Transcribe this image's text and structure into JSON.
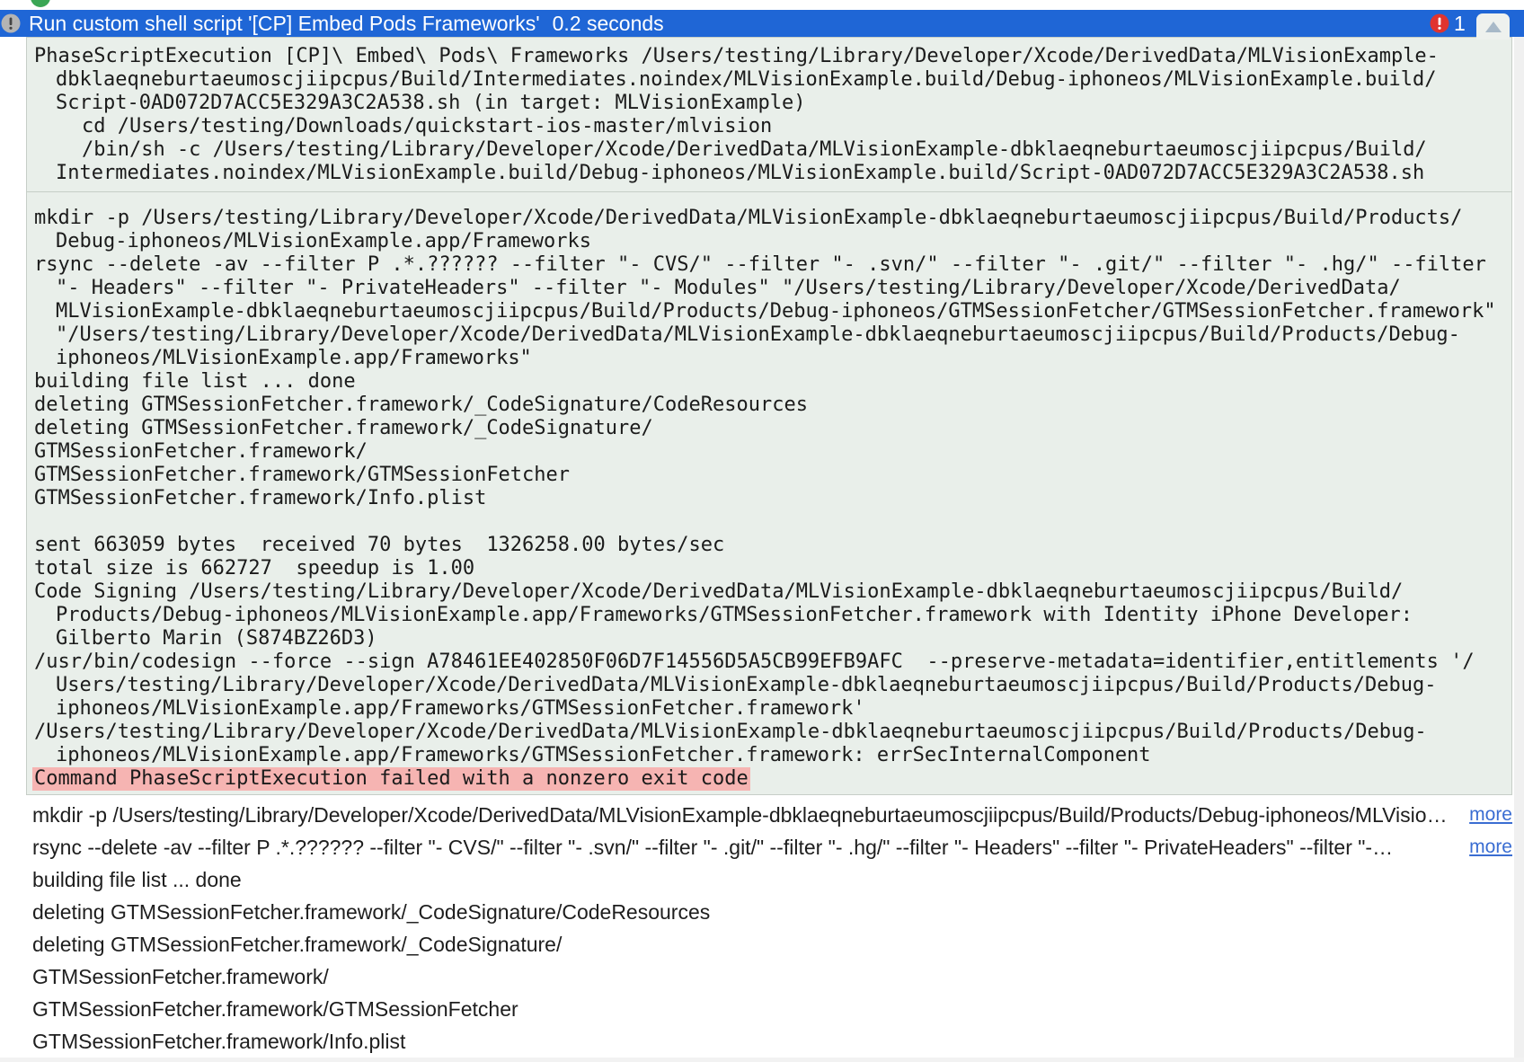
{
  "header": {
    "title": "Run custom shell script '[CP] Embed Pods Frameworks'",
    "duration": "0.2 seconds",
    "status_icon": "exclamation-circle-icon",
    "error_icon": "error-circle-icon",
    "error_count": "1",
    "collapse_icon": "collapse-triangle-icon"
  },
  "log": {
    "command": [
      "PhaseScriptExecution [CP]\\ Embed\\ Pods\\ Frameworks /Users/testing/Library/Developer/Xcode/DerivedData/MLVisionExample-",
      "dbklaeqneburtaeumoscjiipcpus/Build/Intermediates.noindex/MLVisionExample.build/Debug-iphoneos/MLVisionExample.build/",
      "Script-0AD072D7ACC5E329A3C2A538.sh (in target: MLVisionExample)",
      "    cd /Users/testing/Downloads/quickstart-ios-master/mlvision",
      "    /bin/sh -c /Users/testing/Library/Developer/Xcode/DerivedData/MLVisionExample-dbklaeqneburtaeumoscjiipcpus/Build/",
      "Intermediates.noindex/MLVisionExample.build/Debug-iphoneos/MLVisionExample.build/Script-0AD072D7ACC5E329A3C2A538.sh"
    ],
    "output": [
      "mkdir -p /Users/testing/Library/Developer/Xcode/DerivedData/MLVisionExample-dbklaeqneburtaeumoscjiipcpus/Build/Products/",
      "Debug-iphoneos/MLVisionExample.app/Frameworks",
      "rsync --delete -av --filter P .*.?????? --filter \"- CVS/\" --filter \"- .svn/\" --filter \"- .git/\" --filter \"- .hg/\" --filter",
      "\"- Headers\" --filter \"- PrivateHeaders\" --filter \"- Modules\" \"/Users/testing/Library/Developer/Xcode/DerivedData/",
      "MLVisionExample-dbklaeqneburtaeumoscjiipcpus/Build/Products/Debug-iphoneos/GTMSessionFetcher/GTMSessionFetcher.framework\"",
      "\"/Users/testing/Library/Developer/Xcode/DerivedData/MLVisionExample-dbklaeqneburtaeumoscjiipcpus/Build/Products/Debug-",
      "iphoneos/MLVisionExample.app/Frameworks\"",
      "building file list ... done",
      "deleting GTMSessionFetcher.framework/_CodeSignature/CodeResources",
      "deleting GTMSessionFetcher.framework/_CodeSignature/",
      "GTMSessionFetcher.framework/",
      "GTMSessionFetcher.framework/GTMSessionFetcher",
      "GTMSessionFetcher.framework/Info.plist",
      "",
      "sent 663059 bytes  received 70 bytes  1326258.00 bytes/sec",
      "total size is 662727  speedup is 1.00",
      "Code Signing /Users/testing/Library/Developer/Xcode/DerivedData/MLVisionExample-dbklaeqneburtaeumoscjiipcpus/Build/",
      "Products/Debug-iphoneos/MLVisionExample.app/Frameworks/GTMSessionFetcher.framework with Identity iPhone Developer:",
      "Gilberto Marin (S874BZ26D3)",
      "/usr/bin/codesign --force --sign A78461EE402850F06D7F14556D5A5CB99EFB9AFC  --preserve-metadata=identifier,entitlements '/",
      "Users/testing/Library/Developer/Xcode/DerivedData/MLVisionExample-dbklaeqneburtaeumoscjiipcpus/Build/Products/Debug-",
      "iphoneos/MLVisionExample.app/Frameworks/GTMSessionFetcher.framework'",
      "/Users/testing/Library/Developer/Xcode/DerivedData/MLVisionExample-dbklaeqneburtaeumoscjiipcpus/Build/Products/Debug-",
      "iphoneos/MLVisionExample.app/Frameworks/GTMSessionFetcher.framework: errSecInternalComponent"
    ],
    "error": "Command PhaseScriptExecution failed with a nonzero exit code"
  },
  "messages": [
    {
      "text": "mkdir -p /Users/testing/Library/Developer/Xcode/DerivedData/MLVisionExample-dbklaeqneburtaeumoscjiipcpus/Build/Products/Debug-iphoneos/MLVisio…",
      "more": "more"
    },
    {
      "text": "rsync --delete -av --filter P .*.?????? --filter \"- CVS/\" --filter \"- .svn/\" --filter \"- .git/\" --filter \"- .hg/\" --filter \"- Headers\" --filter \"- PrivateHeaders\" --filter \"-…",
      "more": "more"
    },
    {
      "text": "building file list ... done"
    },
    {
      "text": "deleting GTMSessionFetcher.framework/_CodeSignature/CodeResources"
    },
    {
      "text": "deleting GTMSessionFetcher.framework/_CodeSignature/"
    },
    {
      "text": "GTMSessionFetcher.framework/"
    },
    {
      "text": "GTMSessionFetcher.framework/GTMSessionFetcher"
    },
    {
      "text": "GTMSessionFetcher.framework/Info.plist"
    }
  ],
  "colors": {
    "header_bg": "#1f66d6",
    "header_text": "#ffffff",
    "log_bg": "#e9efea",
    "log_border": "#c6cec7",
    "error_highlight": "#f6b4b2",
    "error_badge": "#e0342f",
    "link": "#3a6dd2",
    "success_green": "#3aa655"
  }
}
